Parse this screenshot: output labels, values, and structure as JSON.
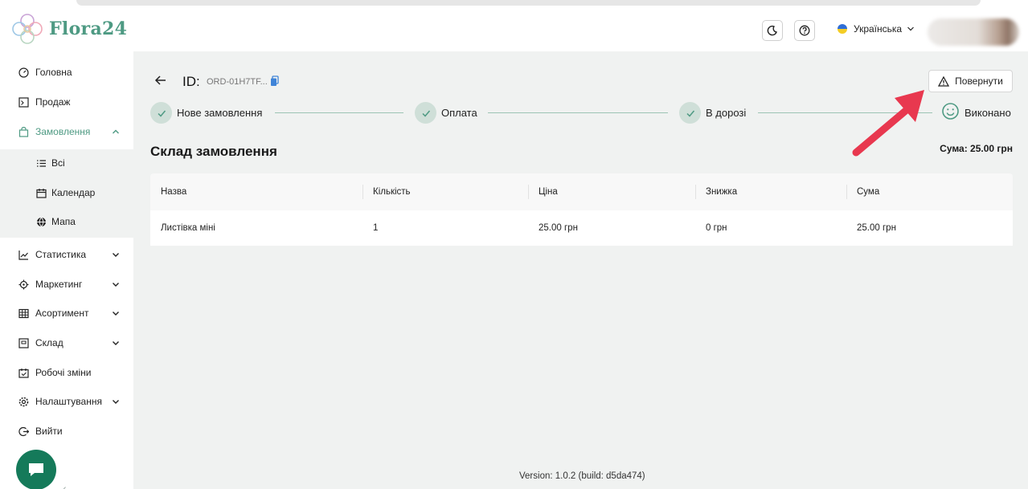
{
  "app": {
    "title": "Flora24"
  },
  "header": {
    "language": "Українська",
    "colors": {
      "brand": "#4e9a83",
      "fab": "#157a5a"
    }
  },
  "sidebar": {
    "items": [
      {
        "label": "Головна",
        "icon": "dashboard-icon"
      },
      {
        "label": "Продаж",
        "icon": "pos-icon"
      },
      {
        "label": "Замовлення",
        "icon": "bag-icon",
        "active": true
      },
      {
        "label": "Статистика",
        "icon": "chart-icon"
      },
      {
        "label": "Маркетинг",
        "icon": "target-icon"
      },
      {
        "label": "Асортимент",
        "icon": "grid-icon"
      },
      {
        "label": "Склад",
        "icon": "box-icon"
      },
      {
        "label": "Робочі зміни",
        "icon": "calendar-check-icon"
      },
      {
        "label": "Налаштування",
        "icon": "gear-icon"
      },
      {
        "label": "Вийти",
        "icon": "logout-icon"
      }
    ],
    "submenu": [
      {
        "label": "Всі",
        "icon": "list-icon"
      },
      {
        "label": "Календар",
        "icon": "calendar-icon"
      },
      {
        "label": "Мапа",
        "icon": "globe-icon"
      }
    ]
  },
  "order": {
    "id_label": "ID:",
    "id_value": "ORD-01H7TF...",
    "return_label": "Повернути",
    "steps": [
      {
        "label": "Нове замовлення"
      },
      {
        "label": "Оплата"
      },
      {
        "label": "В дорозі"
      },
      {
        "label": "Виконано"
      }
    ]
  },
  "composition": {
    "title": "Склад замовлення",
    "total": "Сума: 25.00 грн",
    "columns": [
      "Назва",
      "Кількість",
      "Ціна",
      "Знижка",
      "Сума"
    ],
    "rows": [
      [
        "Листівка міні",
        "1",
        "25.00 грн",
        "0 грн",
        "25.00 грн"
      ]
    ]
  },
  "footer": {
    "version": "Version: 1.0.2 (build: d5da474)"
  }
}
